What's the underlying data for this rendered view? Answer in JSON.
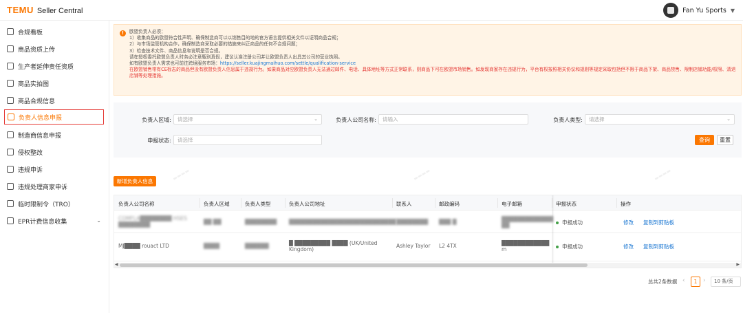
{
  "header": {
    "logo": "TEMU",
    "app_name": "Seller Central",
    "user_name": "Fan Yu Sports"
  },
  "sidebar": {
    "items": [
      {
        "label": "合规看板",
        "icon": "dashboard-icon"
      },
      {
        "label": "商品资质上传",
        "icon": "upload-icon"
      },
      {
        "label": "生产者延伸责任资质",
        "icon": "producer-icon"
      },
      {
        "label": "商品实拍图",
        "icon": "photo-icon"
      },
      {
        "label": "商品合规信息",
        "icon": "doc-icon"
      },
      {
        "label": "负责人信息申报",
        "icon": "person-icon",
        "active": true
      },
      {
        "label": "制造商信息申报",
        "icon": "factory-icon"
      },
      {
        "label": "侵权整改",
        "icon": "warning-icon"
      },
      {
        "label": "违规申诉",
        "icon": "appeal-icon"
      },
      {
        "label": "违规处理商家申诉",
        "icon": "merchant-appeal-icon"
      },
      {
        "label": "临时限制令（TRO）",
        "icon": "tro-icon"
      },
      {
        "label": "EPR计费信息收集",
        "icon": "epr-icon",
        "has_chevron": true
      }
    ]
  },
  "notice": {
    "lines": [
      "欧盟负责人必须：",
      "1）收集商品的欧盟符合性声明、确保制造商可以以销售目的地的官方语言提供相关文件以证明商品合规；",
      "2）与市场监管机构合作，确保制造商采取必要的措施来纠正商品的任何不合规问题；",
      "3）检查技术文件、商品信息和说明是否合规。",
      "请在授权委托欧盟负责人时务必注意甄别真假，建议认准注册公司并让欧盟负责人出具其公司的营业执照。",
      "如有欧盟负责人需求也可前往跨境服务市场："
    ],
    "link": "https://seller.kuajingmaihuo.com/settle/qualification-service",
    "warning": "在欧盟销售带有CE标志的商品但没有欧盟负责人信息属于违规行为。如果商品对应欧盟负责人无法通过邮件、电话、具体地址等方式正常联系，则商品下可在欧盟市场销售。如发现商家存在违规行为，平台有权按照相关协议和规则等规定采取包括但不限于商品下架、商品禁售、限制店铺功能/权限、清退店铺等处理措施。"
  },
  "filter": {
    "region_label": "负责人区域:",
    "region_placeholder": "请选择",
    "company_label": "负责人公司名称:",
    "company_placeholder": "请输入",
    "type_label": "负责人类型:",
    "type_placeholder": "请选择",
    "status_label": "申报状态:",
    "status_placeholder": "请选择",
    "query_button": "查询",
    "reset_button": "重置"
  },
  "add_button": "新增负责人信息",
  "table": {
    "headers": [
      "负责人公司名称",
      "负责人区域",
      "负责人类型",
      "负责人公司地址",
      "联系人",
      "邮政编码",
      "电子邮箱",
      "申报状态",
      "操作"
    ],
    "rows": [
      {
        "company": "COMFLA████████ HSES ████████",
        "region": "██ ██",
        "type": "████████",
        "address": "███████████████████████████",
        "contact": "████████",
        "postcode": "███ █",
        "email": "█████████████ ██",
        "status": "申报成功",
        "actions": [
          "修改",
          "复制到剪贴板"
        ]
      },
      {
        "company": "MJ████ rouact LTD",
        "region": "████",
        "type": "██████",
        "address": "█ █████████ ████ (UK/United Kingdom)",
        "contact": "Ashley Taylor",
        "postcode": "L2 4TX",
        "email": "████████████ m",
        "status": "申报成功",
        "actions": [
          "修改",
          "复制到剪贴板"
        ]
      }
    ]
  },
  "pagination": {
    "total": "总共2条数据",
    "current_page": "1",
    "page_size": "10 条/页"
  },
  "colors": {
    "brand": "#fb7701",
    "link": "#1976d2",
    "success": "#43a047",
    "warning_text": "#e53935"
  }
}
